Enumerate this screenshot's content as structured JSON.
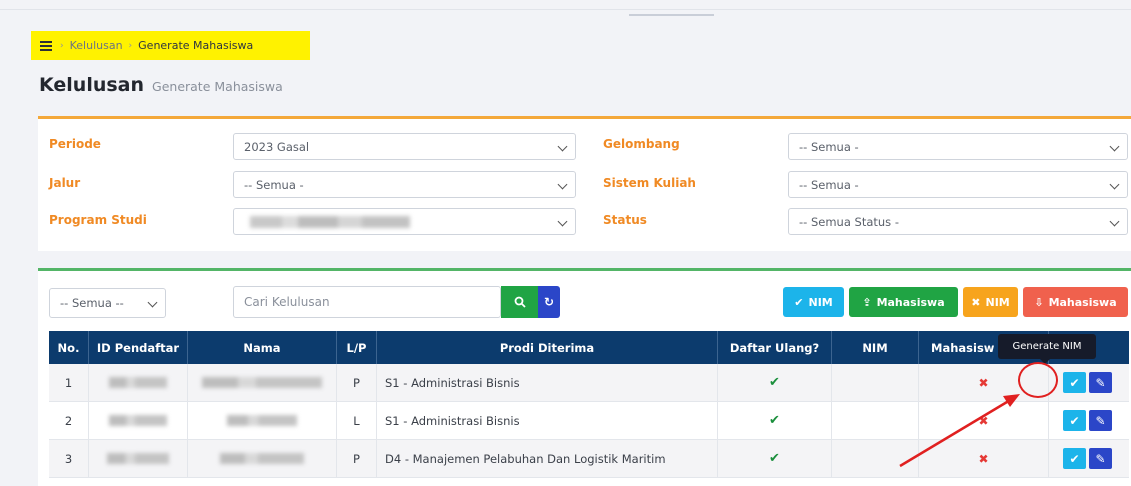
{
  "breadcrumb": {
    "section": "Kelulusan",
    "current": "Generate Mahasiswa"
  },
  "page": {
    "title": "Kelulusan",
    "subtitle": "Generate Mahasiswa"
  },
  "filters": {
    "periode": {
      "label": "Periode",
      "value": "2023 Gasal"
    },
    "gelombang": {
      "label": "Gelombang",
      "value": "-- Semua -"
    },
    "jalur": {
      "label": "Jalur",
      "value": "-- Semua -"
    },
    "sistem_kuliah": {
      "label": "Sistem Kuliah",
      "value": "-- Semua -"
    },
    "program_studi": {
      "label": "Program Studi",
      "value": ""
    },
    "status": {
      "label": "Status",
      "value": "-- Semua Status -"
    }
  },
  "toolbar": {
    "filter_value": "-- Semua --",
    "search_placeholder": "Cari Kelulusan",
    "btn_nim_check": "NIM",
    "btn_mahasiswa_upload": "Mahasiswa",
    "btn_nim_x": "NIM",
    "btn_mahasiswa_download": "Mahasiswa"
  },
  "table": {
    "headers": [
      "No.",
      "ID Pendaftar",
      "Nama",
      "L/P",
      "Prodi Diterima",
      "Daftar Ulang?",
      "NIM",
      "Mahasisw",
      ""
    ],
    "rows": [
      {
        "no": "1",
        "lp": "P",
        "prodi": "S1 - Administrasi Bisnis",
        "daftar_ulang": "✔",
        "nim": "",
        "mahasiswa": "✖"
      },
      {
        "no": "2",
        "lp": "L",
        "prodi": "S1 - Administrasi Bisnis",
        "daftar_ulang": "✔",
        "nim": "",
        "mahasiswa": "✖"
      },
      {
        "no": "3",
        "lp": "P",
        "prodi": "D4 - Manajemen Pelabuhan Dan Logistik Maritim",
        "daftar_ulang": "✔",
        "nim": "",
        "mahasiswa": "✖"
      }
    ]
  },
  "tooltip": "Generate NIM",
  "colors": {
    "header_bg": "#0c3b6d",
    "filter_accent": "#f4a83a",
    "table_accent": "#53b567",
    "highlight": "#fff200",
    "annotation": "#e02020"
  }
}
